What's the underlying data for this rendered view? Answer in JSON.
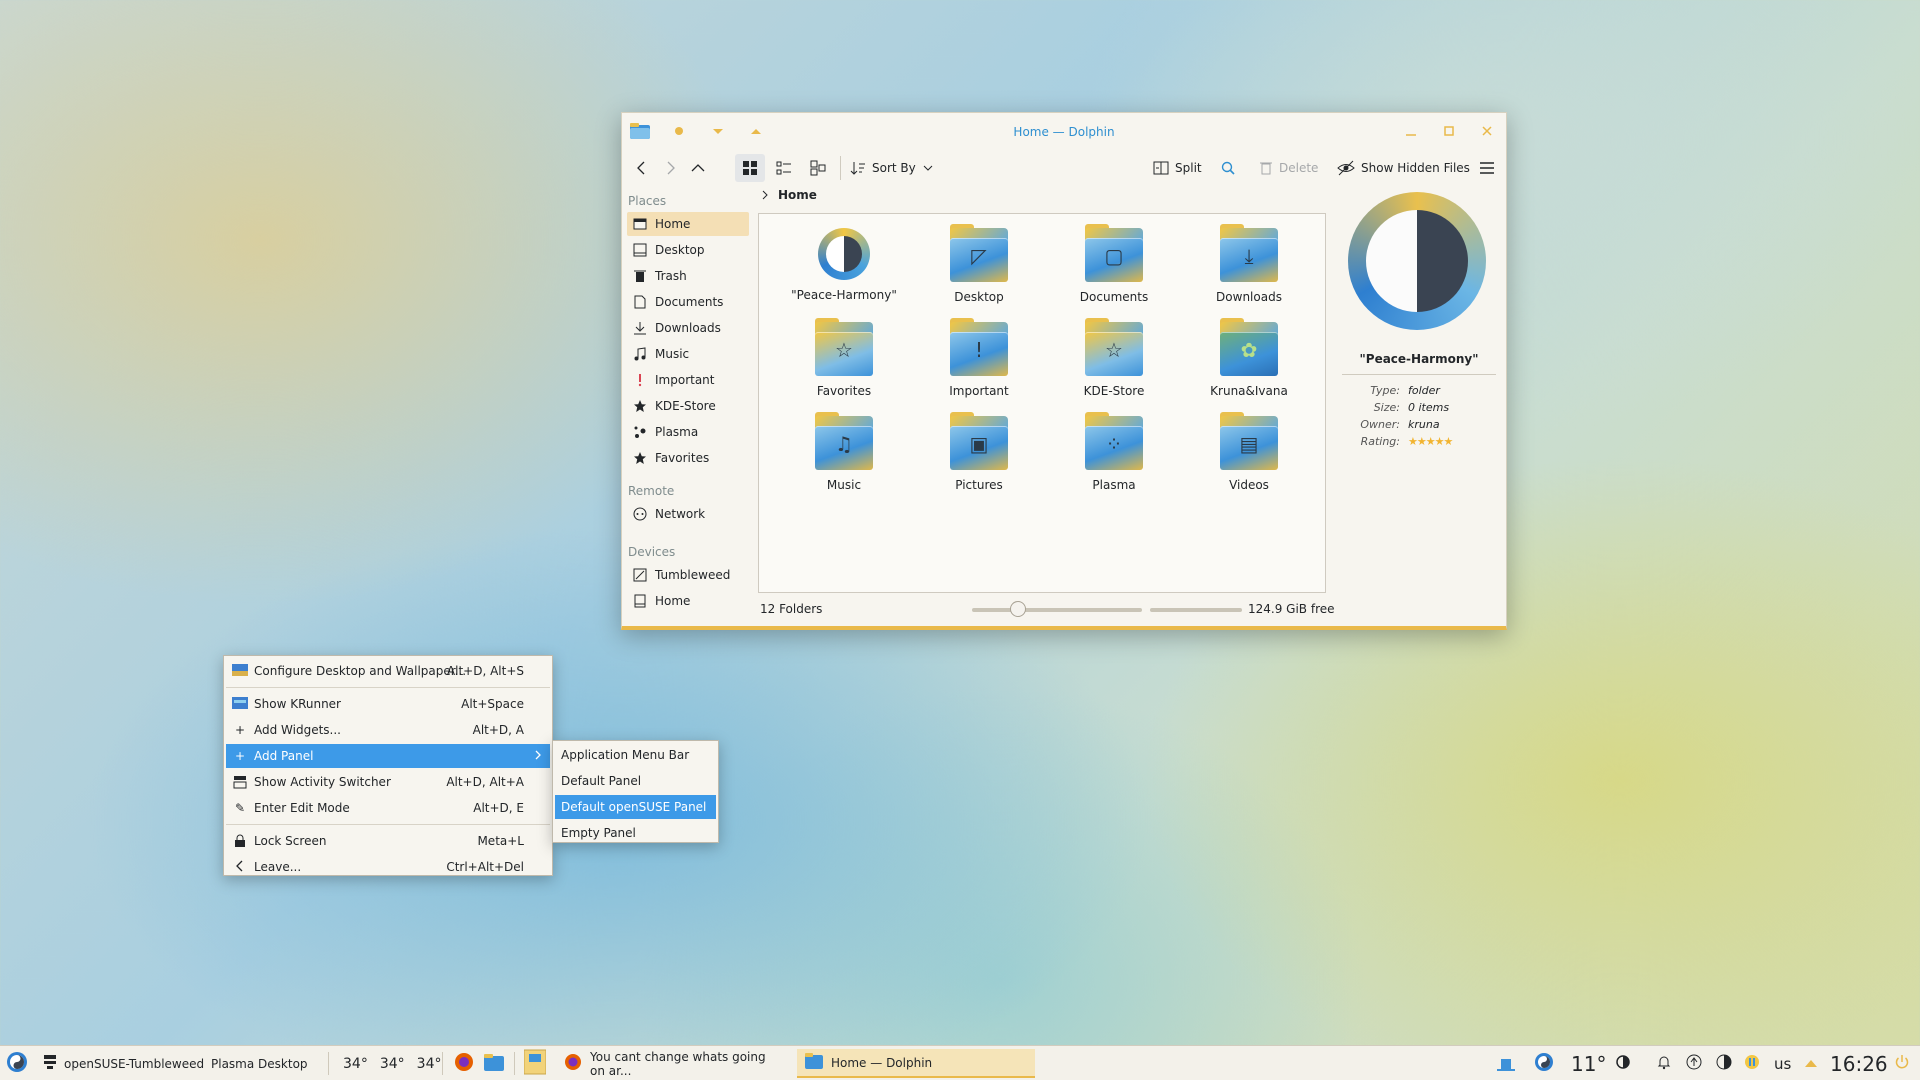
{
  "window": {
    "title": "Home — Dolphin",
    "toolbar": {
      "sort_by": "Sort By",
      "split": "Split",
      "delete": "Delete",
      "show_hidden": "Show Hidden Files"
    },
    "places": {
      "header": "Places",
      "items": [
        {
          "label": "Home",
          "icon": "home-icon"
        },
        {
          "label": "Desktop",
          "icon": "desktop-icon"
        },
        {
          "label": "Trash",
          "icon": "trash-icon"
        },
        {
          "label": "Documents",
          "icon": "documents-icon"
        },
        {
          "label": "Downloads",
          "icon": "download-icon"
        },
        {
          "label": "Music",
          "icon": "music-icon"
        },
        {
          "label": "Important",
          "icon": "exclamation-icon"
        },
        {
          "label": "KDE-Store",
          "icon": "star-icon"
        },
        {
          "label": "Plasma",
          "icon": "plasma-icon"
        },
        {
          "label": "Favorites",
          "icon": "star-icon"
        }
      ],
      "remote_header": "Remote",
      "remote_items": [
        {
          "label": "Network",
          "icon": "network-icon"
        }
      ],
      "devices_header": "Devices",
      "device_items": [
        {
          "label": "Tumbleweed",
          "icon": "drive-icon"
        },
        {
          "label": "Home",
          "icon": "drive-icon"
        }
      ]
    },
    "breadcrumb": "Home",
    "files": [
      {
        "name": "\"Peace-Harmony\"",
        "icon": "yin-yang-icon"
      },
      {
        "name": "Desktop",
        "icon": "desktop-folder-icon"
      },
      {
        "name": "Documents",
        "icon": "documents-folder-icon"
      },
      {
        "name": "Downloads",
        "icon": "downloads-folder-icon"
      },
      {
        "name": "Favorites",
        "icon": "favorites-folder-icon"
      },
      {
        "name": "Important",
        "icon": "important-folder-icon"
      },
      {
        "name": "KDE-Store",
        "icon": "kde-store-folder-icon"
      },
      {
        "name": "Kruna&Ivana",
        "icon": "image-folder-icon"
      },
      {
        "name": "Music",
        "icon": "music-folder-icon"
      },
      {
        "name": "Pictures",
        "icon": "pictures-folder-icon"
      },
      {
        "name": "Plasma",
        "icon": "plasma-folder-icon"
      },
      {
        "name": "Videos",
        "icon": "videos-folder-icon"
      }
    ],
    "info": {
      "name": "\"Peace-Harmony\"",
      "type_label": "Type:",
      "type": "folder",
      "size_label": "Size:",
      "size": "0 items",
      "owner_label": "Owner:",
      "owner": "kruna",
      "rating_label": "Rating:",
      "rating": 5
    },
    "status": {
      "count": "12 Folders",
      "free": "124.9 GiB free"
    }
  },
  "context_menu": {
    "items": [
      {
        "label": "Configure Desktop and Wallpaper...",
        "shortcut": "Alt+D, Alt+S"
      },
      {
        "label": "Show KRunner",
        "shortcut": "Alt+Space"
      },
      {
        "label": "Add Widgets...",
        "shortcut": "Alt+D, A"
      },
      {
        "label": "Add Panel",
        "shortcut": ""
      },
      {
        "label": "Show Activity Switcher",
        "shortcut": "Alt+D, Alt+A"
      },
      {
        "label": "Enter Edit Mode",
        "shortcut": "Alt+D, E"
      },
      {
        "label": "Lock Screen",
        "shortcut": "Meta+L"
      },
      {
        "label": "Leave...",
        "shortcut": "Ctrl+Alt+Del"
      }
    ],
    "submenu": [
      "Application Menu Bar",
      "Default Panel",
      "Default openSUSE Panel",
      "Empty Panel"
    ],
    "highlight_color": "#3d9ae8"
  },
  "taskbar": {
    "activity": "openSUSE-Tumbleweed",
    "desktop": "Plasma Desktop",
    "temps": [
      "34°",
      "34°",
      "34°"
    ],
    "tasks": [
      {
        "label": "You cant change whats going on ar...",
        "icon": "firefox-icon"
      },
      {
        "label": "Home — Dolphin",
        "icon": "dolphin-icon"
      }
    ],
    "weather": "11°",
    "keyboard": "us",
    "clock": "16:26"
  },
  "colors": {
    "accent": "#2e8fd0",
    "window_bg": "#f7f5ef",
    "selection": "#f4dfb5"
  }
}
